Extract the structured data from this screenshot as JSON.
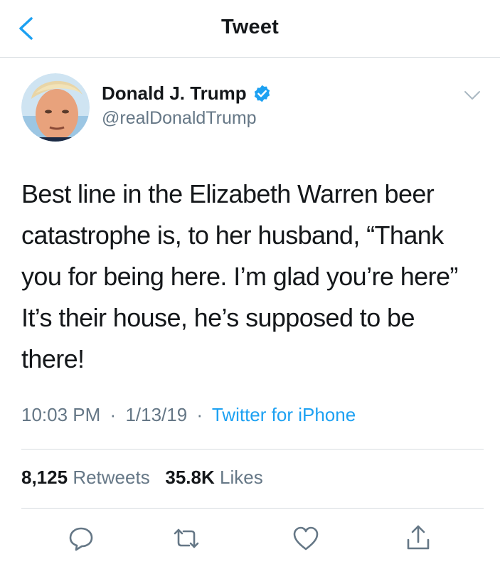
{
  "header": {
    "title": "Tweet",
    "back_icon": "chevron-left-icon"
  },
  "author": {
    "display_name": "Donald J. Trump",
    "handle": "@realDonaldTrump",
    "verified": true
  },
  "tweet": {
    "text": "Best line in the Elizabeth Warren beer catastrophe is, to her husband, “Thank you for being here. I’m glad you’re here” It’s their house, he’s supposed to be there!",
    "time": "10:03 PM",
    "date": "1/13/19",
    "source": "Twitter for iPhone",
    "separator": "·"
  },
  "stats": {
    "retweets_count": "8,125",
    "retweets_label": "Retweets",
    "likes_count": "35.8K",
    "likes_label": "Likes"
  },
  "actions": [
    "reply-icon",
    "retweet-icon",
    "like-icon",
    "share-icon"
  ],
  "colors": {
    "accent": "#1da1f2",
    "secondary_text": "#657786",
    "primary_text": "#14171a",
    "divider": "#d7dce0"
  }
}
